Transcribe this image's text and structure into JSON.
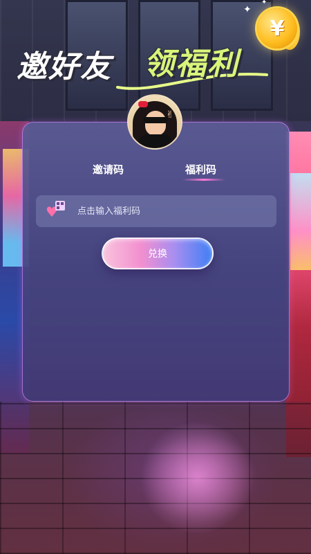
{
  "banner": {
    "title_part1": "邀好友",
    "title_part2": "领福利",
    "coin_symbol": "¥"
  },
  "tabs": [
    {
      "label": "邀请码",
      "active": false
    },
    {
      "label": "福利码",
      "active": true
    }
  ],
  "redeem_form": {
    "placeholder": "点击输入福利码",
    "button_label": "兑换"
  },
  "colors": {
    "card": "#4f4d8a",
    "accent_pink": "#ff7ad9",
    "accent_blue": "#3f7ff5",
    "banner_highlight": "#d8f57a",
    "coin": "#ffbe21"
  },
  "icons": {
    "input_icon": "heart-qr-icon",
    "coin": "yuan-coin-icon"
  }
}
